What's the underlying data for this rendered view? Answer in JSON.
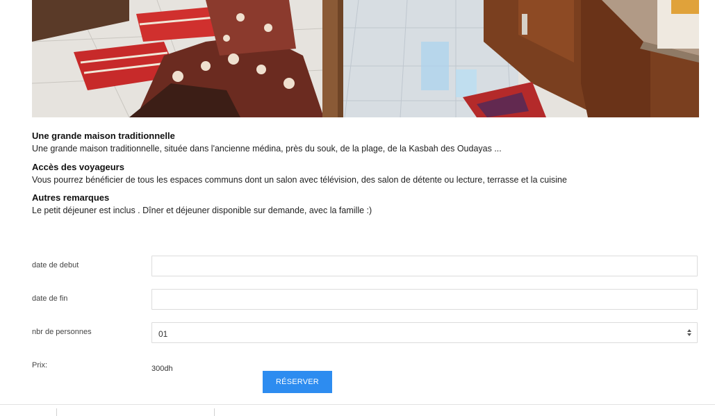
{
  "listing": {
    "photo_icon": "interior-photo",
    "sections": [
      {
        "title": "Une grande maison traditionnelle",
        "text": "Une grande maison traditionnelle, située dans l'ancienne médina, près du souk, de la plage, de la Kasbah des Oudayas ..."
      },
      {
        "title": "Accès des voyageurs",
        "text": "Vous pourrez bénéficier de tous les espaces communs dont un salon avec télévision, des salon de détente ou lecture, terrasse et la cuisine"
      },
      {
        "title": "Autres remarques",
        "text": "Le petit déjeuner est inclus . Dîner et déjeuner disponible sur demande, avec la famille :)"
      }
    ]
  },
  "booking": {
    "start_label": "date de debut",
    "start_value": "",
    "end_label": "date de fin",
    "end_value": "",
    "persons_label": "nbr de personnes",
    "persons_value": "01",
    "price_label": "Prix:",
    "price_value": "300dh",
    "reserve_label": "RÉSERVER"
  },
  "colors": {
    "accent": "#2d8cf0"
  }
}
